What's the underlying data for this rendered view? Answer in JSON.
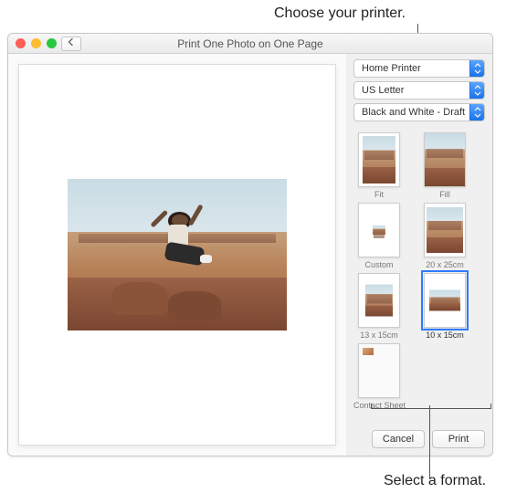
{
  "annotations": {
    "choose_printer": "Choose your printer.",
    "select_format": "Select a format."
  },
  "window": {
    "title": "Print One Photo on One Page"
  },
  "dropdowns": {
    "printer": "Home Printer",
    "paper": "US Letter",
    "quality": "Black and White - Draft"
  },
  "formats": {
    "fit": "Fit",
    "fill": "Fill",
    "custom": "Custom",
    "20x25": "20 x 25cm",
    "13x15": "13 x 15cm",
    "10x15": "10 x 15cm",
    "contact": "Contact Sheet"
  },
  "buttons": {
    "cancel": "Cancel",
    "print": "Print"
  }
}
